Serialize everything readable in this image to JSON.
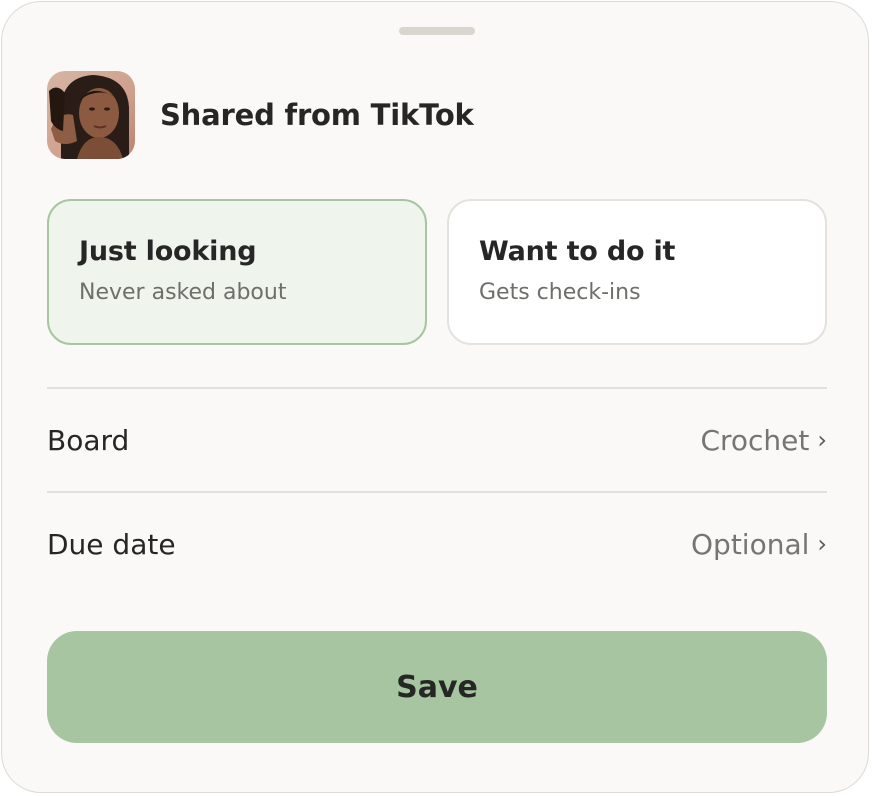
{
  "source": {
    "title": "Shared from TikTok",
    "thumbnail": "video-thumbnail"
  },
  "options": [
    {
      "title": "Just looking",
      "subtitle": "Never asked about",
      "selected": true
    },
    {
      "title": "Want to do it",
      "subtitle": "Gets check-ins",
      "selected": false
    }
  ],
  "rows": {
    "board": {
      "label": "Board",
      "value": "Crochet",
      "chevron": "›"
    },
    "due_date": {
      "label": "Due date",
      "value": "Optional",
      "chevron": "›"
    }
  },
  "save_label": "Save",
  "colors": {
    "accent": "#a7c5a0",
    "selected_bg": "#eff4ec",
    "sheet_bg": "#faf9f7",
    "text": "#262626",
    "muted": "#767572"
  }
}
